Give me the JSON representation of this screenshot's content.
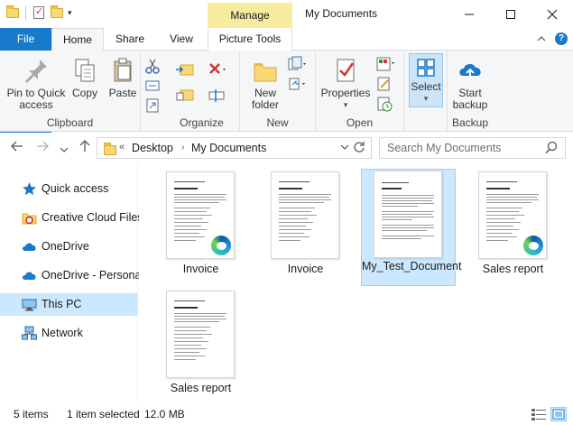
{
  "window": {
    "title": "My Documents",
    "manage_label": "Manage",
    "minimize": "—",
    "maximize": "☐",
    "close": "✕"
  },
  "ribbon_tabs": {
    "file": "File",
    "home": "Home",
    "share": "Share",
    "view": "View",
    "picture_tools": "Picture Tools"
  },
  "ribbon": {
    "clipboard": {
      "label": "Clipboard",
      "pin": "Pin to Quick access",
      "copy": "Copy",
      "paste": "Paste"
    },
    "organize": {
      "label": "Organize"
    },
    "new": {
      "label": "New",
      "new_folder": "New folder"
    },
    "open": {
      "label": "Open",
      "properties": "Properties"
    },
    "select": {
      "label": "Select"
    },
    "backup": {
      "label": "Backup",
      "start_backup": "Start backup"
    }
  },
  "address": {
    "prefix": "«",
    "crumbs": [
      "Desktop",
      "My Documents"
    ],
    "search_placeholder": "Search My Documents"
  },
  "nav": {
    "items": [
      {
        "label": "Quick access",
        "icon": "star-icon"
      },
      {
        "label": "Creative Cloud Files",
        "icon": "creative-cloud-icon"
      },
      {
        "label": "OneDrive",
        "icon": "cloud-icon"
      },
      {
        "label": "OneDrive - Personal",
        "icon": "cloud-icon"
      },
      {
        "label": "This PC",
        "icon": "computer-icon",
        "selected": true
      },
      {
        "label": "Network",
        "icon": "network-icon"
      }
    ]
  },
  "files": [
    {
      "name": "Invoice",
      "edge": true
    },
    {
      "name": "Invoice",
      "edge": false
    },
    {
      "name": "My_Test_Document",
      "edge": false,
      "selected": true
    },
    {
      "name": "Sales report",
      "edge": true
    },
    {
      "name": "Sales report",
      "edge": false
    }
  ],
  "status": {
    "items_count": "5 items",
    "selection": "1 item selected",
    "size": "12.0 MB"
  },
  "colors": {
    "accent": "#1979ca",
    "manage_tab": "#f7eba0",
    "selection": "#cce8ff"
  }
}
